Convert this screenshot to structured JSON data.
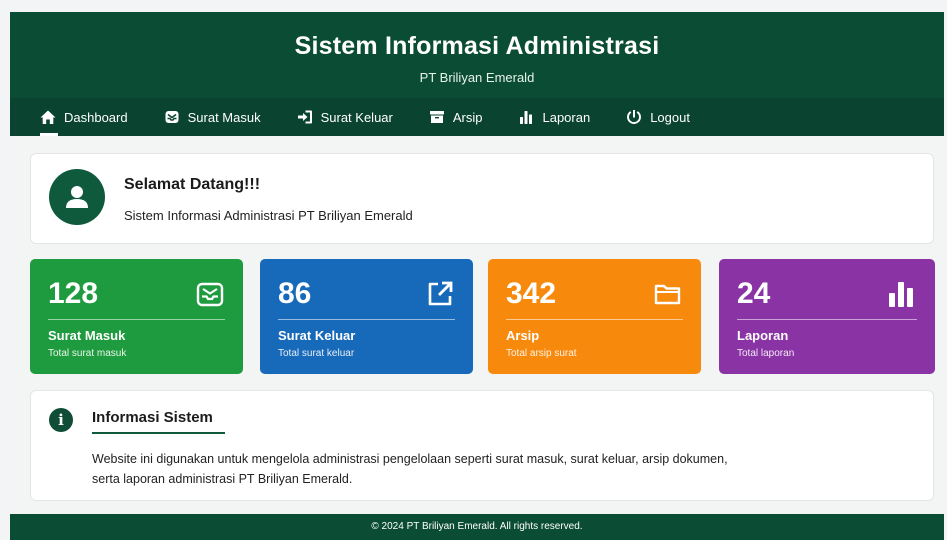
{
  "header": {
    "title": "Sistem Informasi Administrasi",
    "subtitle": "PT Briliyan Emerald"
  },
  "nav": {
    "items": [
      {
        "label": "Dashboard",
        "icon": "home-icon"
      },
      {
        "label": "Surat Masuk",
        "icon": "inbox-icon"
      },
      {
        "label": "Surat Keluar",
        "icon": "sign-out-icon"
      },
      {
        "label": "Arsip",
        "icon": "archive-icon"
      },
      {
        "label": "Laporan",
        "icon": "bar-chart-icon"
      },
      {
        "label": "Logout",
        "icon": "power-icon"
      }
    ]
  },
  "welcome": {
    "title": "Selamat Datang!!!",
    "subtitle": "Sistem Informasi Administrasi PT Briliyan Emerald"
  },
  "cards": [
    {
      "value": "128",
      "label": "Surat Masuk",
      "desc": "Total surat masuk",
      "color": "#1f9b3f",
      "icon": "inbox-icon"
    },
    {
      "value": "86",
      "label": "Surat Keluar",
      "desc": "Total surat keluar",
      "color": "#1769b9",
      "icon": "external-link-icon"
    },
    {
      "value": "342",
      "label": "Arsip",
      "desc": "Total arsip surat",
      "color": "#f7890d",
      "icon": "folder-icon"
    },
    {
      "value": "24",
      "label": "Laporan",
      "desc": "Total laporan",
      "color": "#8a33a5",
      "icon": "bar-chart-icon"
    }
  ],
  "info": {
    "title": "Informasi Sistem",
    "body": "Website ini digunakan untuk mengelola administrasi pengelolaan seperti surat masuk, surat keluar, arsip dokumen, serta laporan administrasi PT Briliyan Emerald."
  },
  "footer": {
    "text": "© 2024 PT Briliyan Emerald. All rights reserved."
  },
  "colors": {
    "primary": "#0b4d34",
    "nav": "#0a4330"
  }
}
